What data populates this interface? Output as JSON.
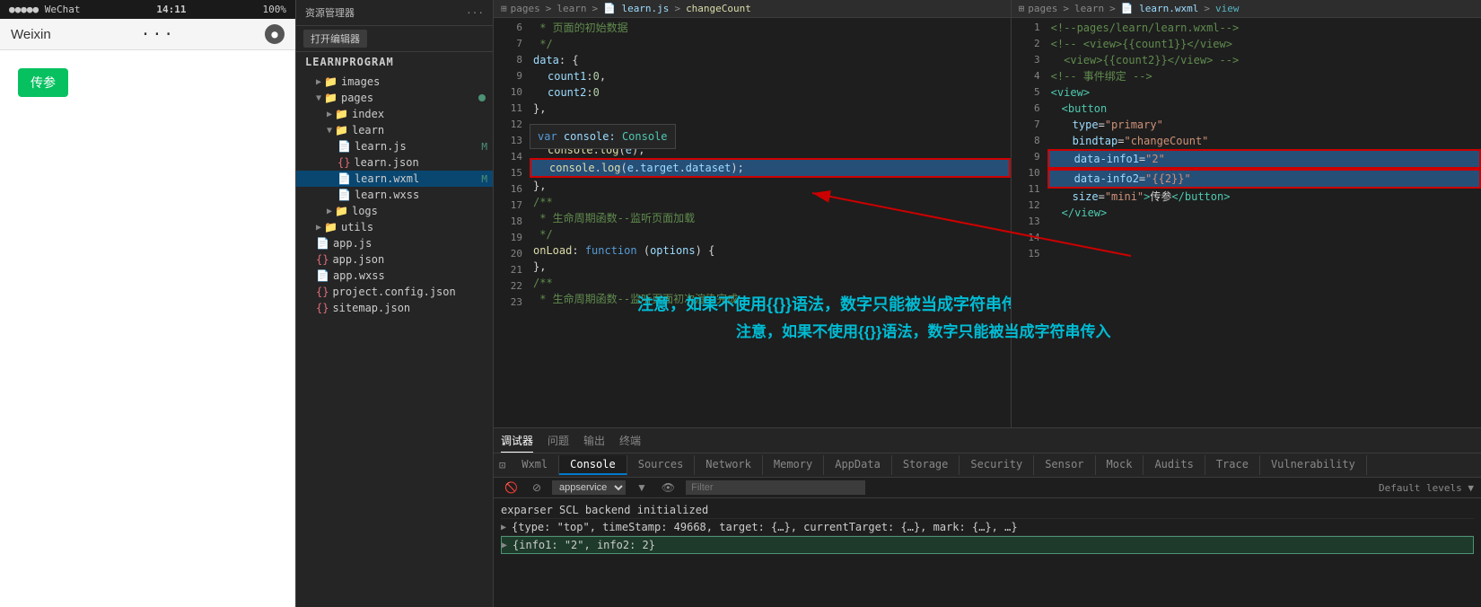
{
  "phone": {
    "status": {
      "signal": "●●●●● WeChat",
      "time": "14:11",
      "battery": "100%"
    },
    "nav": {
      "title": "Weixin",
      "dots": "···"
    },
    "button": "传参"
  },
  "explorer": {
    "header": "资源管理器",
    "open_btn": "打开编辑器",
    "project": "LEARNPROGRAM",
    "tree": [
      {
        "indent": 1,
        "type": "folder",
        "name": "images",
        "expanded": false
      },
      {
        "indent": 1,
        "type": "folder",
        "name": "pages",
        "expanded": true
      },
      {
        "indent": 2,
        "type": "folder",
        "name": "index",
        "expanded": false
      },
      {
        "indent": 2,
        "type": "folder",
        "name": "learn",
        "expanded": true
      },
      {
        "indent": 3,
        "type": "file-js",
        "name": "learn.js",
        "badge": "M"
      },
      {
        "indent": 3,
        "type": "file-json",
        "name": "learn.json"
      },
      {
        "indent": 3,
        "type": "file-wxml",
        "name": "learn.wxml",
        "badge": "M",
        "active": true
      },
      {
        "indent": 3,
        "type": "file-wxss",
        "name": "learn.wxss"
      },
      {
        "indent": 1,
        "type": "folder",
        "name": "logs",
        "expanded": false
      },
      {
        "indent": 1,
        "type": "folder",
        "name": "utils",
        "expanded": false
      },
      {
        "indent": 1,
        "type": "file-js",
        "name": "app.js"
      },
      {
        "indent": 1,
        "type": "file-json",
        "name": "app.json"
      },
      {
        "indent": 1,
        "type": "file-wxss",
        "name": "app.wxss"
      },
      {
        "indent": 1,
        "type": "file-json",
        "name": "project.config.json"
      },
      {
        "indent": 1,
        "type": "file-json",
        "name": "sitemap.json"
      }
    ]
  },
  "editor_left": {
    "breadcrumb": [
      "pages",
      "learn",
      "learn.js",
      "changeCount"
    ],
    "lines": [
      {
        "num": 6,
        "text": " * 页面的初始数据"
      },
      {
        "num": 7,
        "text": " */"
      },
      {
        "num": 8,
        "text": "data: {"
      },
      {
        "num": 9,
        "text": "  count1:0,"
      },
      {
        "num": 10,
        "text": "  count2:0"
      },
      {
        "num": 11,
        "text": "},"
      },
      {
        "num": 12,
        "text": "changeCount: {"
      },
      {
        "num": 13,
        "text": "  console.log(e);"
      },
      {
        "num": 13,
        "text": "  console.log(e.target.dataset);"
      },
      {
        "num": 14,
        "text": "},"
      },
      {
        "num": 15,
        "text": "/**"
      },
      {
        "num": 16,
        "text": " * 生命周期函数--监听页面加载"
      },
      {
        "num": 17,
        "text": " */"
      },
      {
        "num": 18,
        "text": "onLoad: function (options) {"
      },
      {
        "num": 19,
        "text": ""
      },
      {
        "num": 20,
        "text": "},"
      },
      {
        "num": 21,
        "text": ""
      },
      {
        "num": 22,
        "text": "/**"
      },
      {
        "num": 23,
        "text": " * 生命周期函数--监听页面初次渲染完成"
      }
    ],
    "tooltip": "var console: Console"
  },
  "editor_right": {
    "breadcrumb": [
      "pages",
      "learn",
      "learn.wxml",
      "view"
    ],
    "lines": [
      {
        "num": 1,
        "text": "<!--pages/learn/learn.wxml-->"
      },
      {
        "num": 2,
        "text": ""
      },
      {
        "num": 3,
        "text": "<!-- <view>{{count1}}</view>"
      },
      {
        "num": 4,
        "text": "  <view>{{count2}}</view> -->"
      },
      {
        "num": 5,
        "text": ""
      },
      {
        "num": 6,
        "text": "<!-- 事件绑定 -->"
      },
      {
        "num": 7,
        "text": ""
      },
      {
        "num": 8,
        "text": "<view>"
      },
      {
        "num": 9,
        "text": "  <button"
      },
      {
        "num": 10,
        "text": "    type=\"primary\""
      },
      {
        "num": 11,
        "text": "    bindtap=\"changeCount\""
      },
      {
        "num": 12,
        "text": "    data-info1=\"2\""
      },
      {
        "num": 13,
        "text": "    data-info2=\"{{2}}\""
      },
      {
        "num": 14,
        "text": "    size=\"mini\"> 传参 </button>"
      },
      {
        "num": 15,
        "text": "  </view>"
      }
    ]
  },
  "annotation": "注意，如果不使用{{}}语法，数字只能被当成字符串传入",
  "bottom": {
    "tabs": [
      "调试器",
      "问题",
      "输出",
      "终端"
    ],
    "active_tab": "调试器",
    "console_tabs": [
      "Wxml",
      "Console",
      "Sources",
      "Network",
      "Memory",
      "AppData",
      "Storage",
      "Security",
      "Sensor",
      "Mock",
      "Audits",
      "Trace",
      "Vulnerability"
    ],
    "active_console_tab": "Console",
    "toolbar": {
      "appservice": "appservice",
      "filter_placeholder": "Filter",
      "default_levels": "Default levels ▼"
    },
    "console_lines": [
      {
        "text": "exparser SCL backend initialized",
        "type": "info"
      },
      {
        "text": "▶ {type: \"top\", timeStamp: 49668, target: {…}, currentTarget: {…}, mark: {…}, …}",
        "type": "object"
      },
      {
        "text": "▶ {info1: \"2\", info2: 2}",
        "type": "object",
        "highlighted": true
      }
    ]
  }
}
